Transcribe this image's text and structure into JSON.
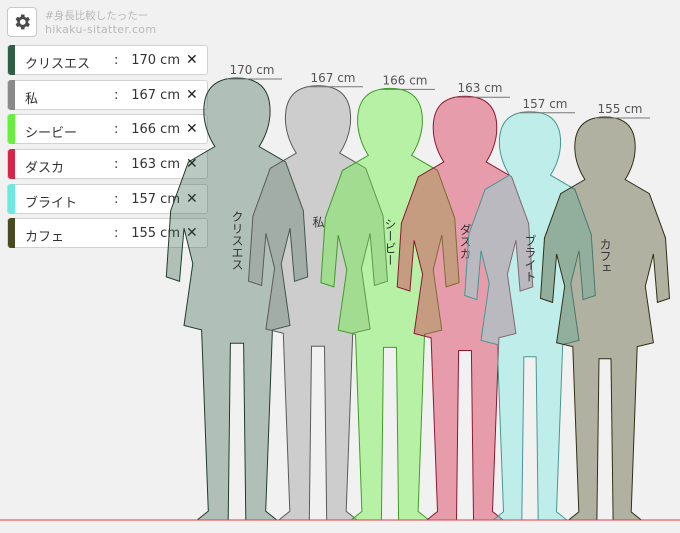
{
  "brand": {
    "hashtag": "#身長比較したったー",
    "url": "hikaku-sitatter.com"
  },
  "settings_icon": "gear-icon",
  "unit": "cm",
  "separator": ":",
  "remove_glyph": "✕",
  "people": [
    {
      "name": "クリスエス",
      "height_cm": 170,
      "height_label": "170 cm",
      "color": "#2f5d46"
    },
    {
      "name": "私",
      "height_cm": 167,
      "height_label": "167 cm",
      "color": "#8a8a8a"
    },
    {
      "name": "シービー",
      "height_cm": 166,
      "height_label": "166 cm",
      "color": "#66f03c"
    },
    {
      "name": "ダスカ",
      "height_cm": 163,
      "height_label": "163 cm",
      "color": "#d8264a"
    },
    {
      "name": "ブライト",
      "height_cm": 157,
      "height_label": "157 cm",
      "color": "#6ee9df"
    },
    {
      "name": "カフェ",
      "height_cm": 155,
      "height_label": "155 cm",
      "color": "#4a4a22"
    }
  ],
  "ground_line_color": "#e04040"
}
